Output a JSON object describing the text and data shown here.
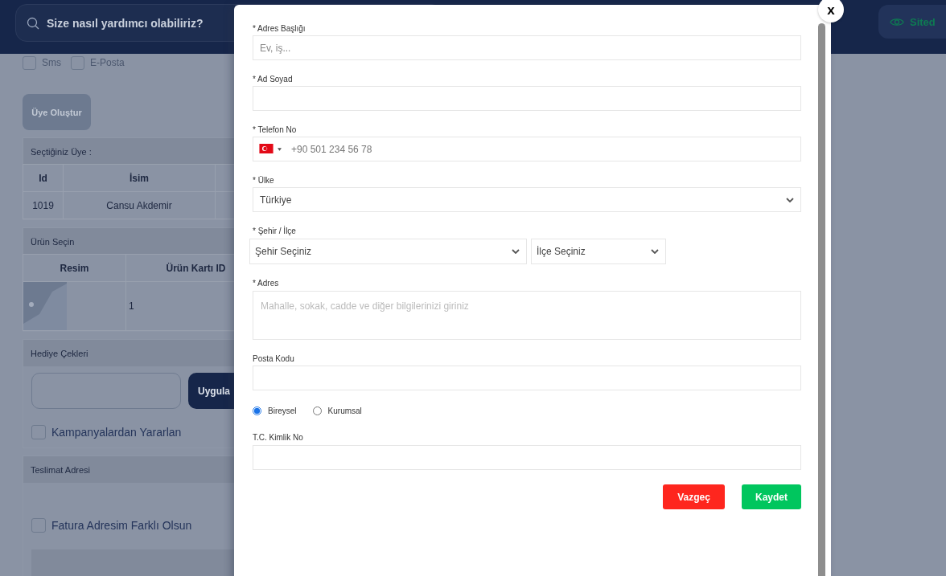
{
  "header": {
    "search": {
      "placeholder": "Size nasıl yardımcı olabiliriz?"
    },
    "site_button": {
      "label": "Sited"
    }
  },
  "background": {
    "notify_options": [
      {
        "label": "Sms",
        "checked": false
      },
      {
        "label": "E-Posta",
        "checked": false
      }
    ],
    "create_member_button": {
      "label": "Üye Oluştur"
    },
    "selected_member": {
      "title": "Seçtiğiniz Üye :",
      "columns": [
        "Id",
        "İsim"
      ],
      "rows": [
        [
          "1019",
          "Cansu Akdemir"
        ]
      ]
    },
    "product_select": {
      "title": "Ürün Seçin",
      "columns": [
        "Resim",
        "Ürün Kartı ID"
      ],
      "rows": [
        {
          "card_id": "1"
        }
      ]
    },
    "gift_cards": {
      "title": "Hediye Çekleri",
      "apply_button": {
        "label": "Uygula"
      },
      "campaign": {
        "label": "Kampanyalardan Yararlan",
        "checked": false
      }
    },
    "delivery": {
      "title": "Teslimat Adresi",
      "different_invoice": {
        "label": "Fatura Adresim Farklı Olsun",
        "checked": false
      }
    }
  },
  "modal": {
    "close": {
      "label": "x"
    },
    "fields": [
      {
        "kind": "text",
        "label": "* Adres Başlığı",
        "placeholder": "Ev, iş..."
      },
      {
        "kind": "text",
        "label": "* Ad Soyad"
      },
      {
        "kind": "phone",
        "label": "* Telefon No",
        "placeholder": "+90 501 234 56 78"
      },
      {
        "kind": "select",
        "label": "* Ülke",
        "value": "Türkiye"
      },
      {
        "kind": "select_pair",
        "label": "* Şehir / İlçe",
        "options": [
          {
            "value": "Şehir Seçiniz"
          },
          {
            "value": "İlçe Seçiniz"
          }
        ]
      },
      {
        "kind": "textarea",
        "label": "* Adres",
        "placeholder": "Mahalle, sokak, cadde ve diğer bilgilerinizi giriniz"
      },
      {
        "kind": "text",
        "label": "Posta Kodu"
      },
      {
        "kind": "radio",
        "options": [
          {
            "label": "Bireysel",
            "selected": true
          },
          {
            "label": "Kurumsal",
            "selected": false
          }
        ]
      },
      {
        "kind": "text",
        "label": "T.C. Kimlik No"
      }
    ],
    "buttons": [
      {
        "kind": "cancel",
        "label": "Vazgeç"
      },
      {
        "kind": "save",
        "label": "Kaydet"
      }
    ]
  }
}
